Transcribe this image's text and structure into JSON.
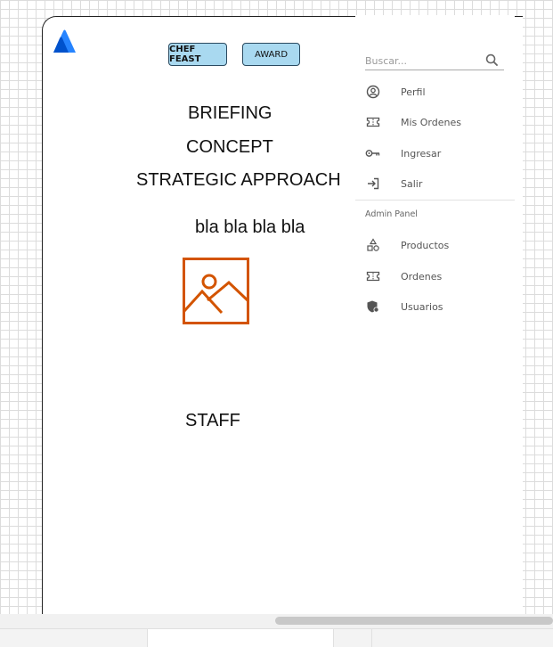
{
  "canvas": {
    "buttons": [
      "CHEF FEAST",
      "AWARD"
    ],
    "headings": [
      "BRIEFING",
      "CONCEPT",
      "STRATEGIC APPROACH"
    ],
    "body_text": "bla bla bla bla",
    "staff_heading": "STAFF",
    "logo_icon": "atlassian-logo",
    "image_placeholder_icon": "image-icon",
    "accent_color": "#d35400",
    "chip_color": "#a9d9f0"
  },
  "drawer": {
    "search": {
      "placeholder": "Buscar...",
      "value": "",
      "icon": "search-icon"
    },
    "menu": [
      {
        "label": "Perfil",
        "icon": "account-circle-icon"
      },
      {
        "label": "Mis Ordenes",
        "icon": "ticket-icon"
      },
      {
        "label": "Ingresar",
        "icon": "key-icon"
      },
      {
        "label": "Salir",
        "icon": "logout-icon"
      }
    ],
    "admin_section_label": "Admin Panel",
    "admin_menu": [
      {
        "label": "Productos",
        "icon": "category-icon"
      },
      {
        "label": "Ordenes",
        "icon": "ticket-icon"
      },
      {
        "label": "Usuarios",
        "icon": "admin-shield-icon"
      }
    ]
  }
}
